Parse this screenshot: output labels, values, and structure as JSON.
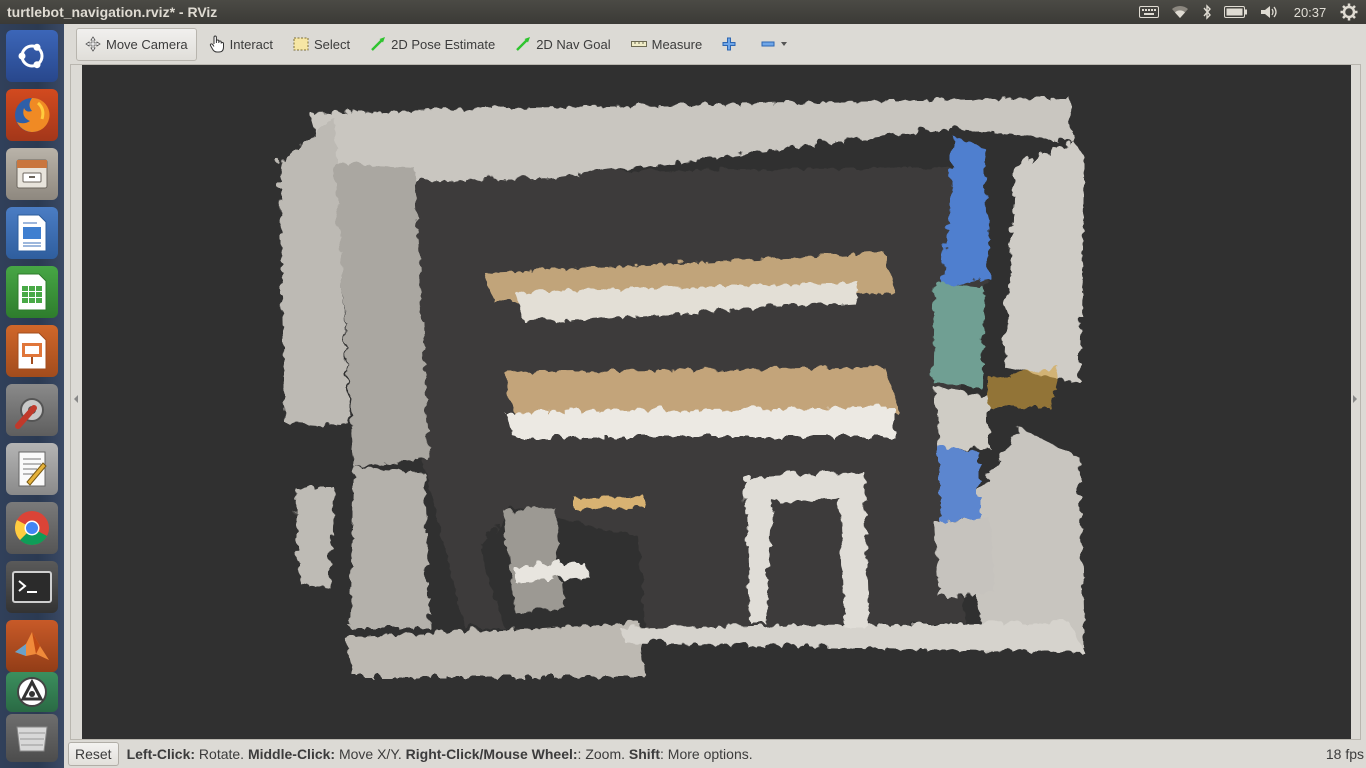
{
  "window": {
    "title": "turtlebot_navigation.rviz* - RViz"
  },
  "top_panel": {
    "clock": "20:37",
    "indicators": [
      "keyboard-icon",
      "wifi-icon",
      "bluetooth-icon",
      "battery-icon",
      "volume-icon",
      "settings-gear-icon"
    ]
  },
  "launcher": {
    "items": [
      "ubuntu-dash",
      "firefox",
      "files",
      "libreoffice-writer",
      "libreoffice-calc",
      "libreoffice-impress",
      "system-settings",
      "text-editor",
      "chrome",
      "terminal",
      "matlab",
      "software-updater",
      "trash"
    ]
  },
  "toolbar": {
    "move_camera": "Move Camera",
    "interact": "Interact",
    "select": "Select",
    "pose_estimate": "2D Pose Estimate",
    "nav_goal": "2D Nav Goal",
    "measure": "Measure"
  },
  "status": {
    "reset": "Reset",
    "left_click_key": "Left-Click:",
    "left_click_val": " Rotate. ",
    "middle_click_key": "Middle-Click:",
    "middle_click_val": " Move X/Y. ",
    "right_click_key": "Right-Click/Mouse Wheel:",
    "right_click_val": ": Zoom. ",
    "shift_key": "Shift",
    "shift_val": ": More options.",
    "fps": "18 fps"
  },
  "colors": {
    "viewport_bg": "#303030",
    "panel_bg": "#3c3b37",
    "launcher_bg": "#2d3b54",
    "window_bg": "#dcdad5"
  }
}
